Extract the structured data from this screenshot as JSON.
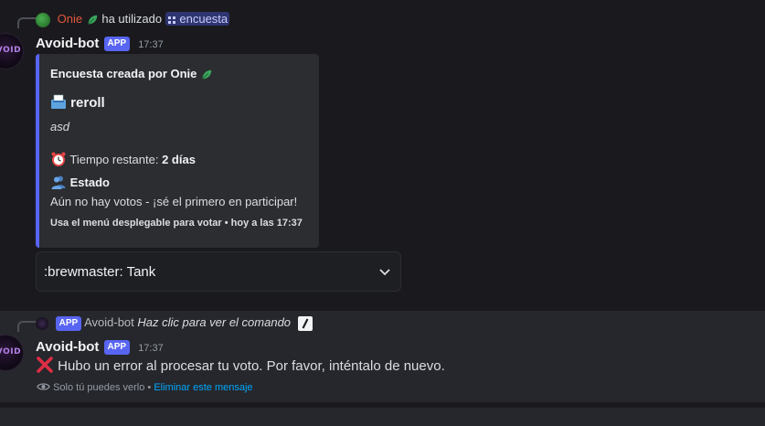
{
  "message1": {
    "reply": {
      "user": "Onie",
      "action": "ha utilizado",
      "command": "encuesta"
    },
    "author": "Avoid-bot",
    "badge": "APP",
    "timestamp": "17:37",
    "avatar_text": "AVOID",
    "embed": {
      "author": "Encuesta creada por Onie",
      "title": "reroll",
      "description": "asd",
      "time_label": "Tiempo restante: ",
      "time_value": "2 días",
      "field_name": "Estado",
      "field_value": "Aún no hay votos - ¡sé el primero en participar!",
      "footer": "Usa el menú desplegable para votar • hoy a las 17:37",
      "accent_color": "#5865f2"
    },
    "select": {
      "value": ":brewmaster: Tank"
    }
  },
  "message2": {
    "reply": {
      "badge": "APP",
      "user": "Avoid-bot",
      "action": "Haz clic para ver el comando"
    },
    "author": "Avoid-bot",
    "badge": "APP",
    "timestamp": "17:37",
    "avatar_text": "AVOID",
    "text": "Hubo un error al procesar tu voto. Por favor, inténtalo de nuevo.",
    "ephemeral_note": "Solo tú puedes verlo •",
    "dismiss_link": "Eliminar este mensaje"
  }
}
